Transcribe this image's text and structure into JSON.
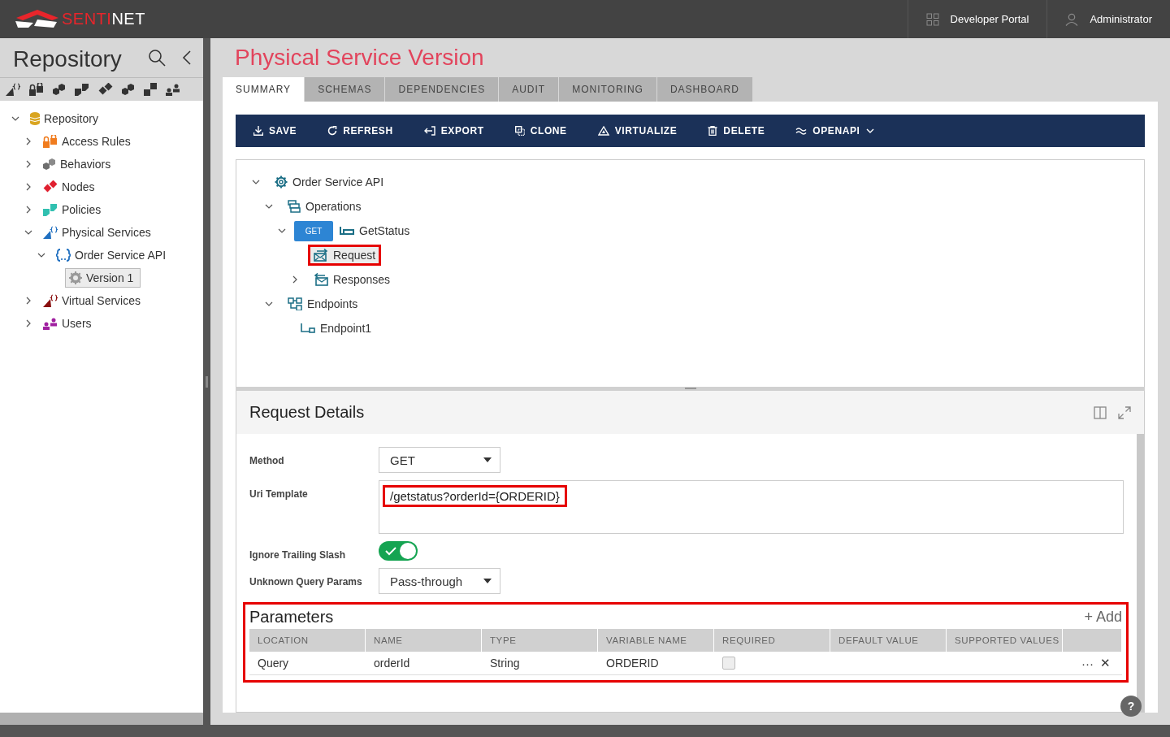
{
  "header": {
    "logo": {
      "accent": "SENTI",
      "rest": "NET"
    },
    "links": [
      {
        "label": "Developer Portal",
        "kind": "grid"
      },
      {
        "label": "Administrator",
        "kind": "user"
      }
    ]
  },
  "sidebar": {
    "title": "Repository",
    "tree": [
      {
        "label": "Repository",
        "kind": "database",
        "expanded": true,
        "selected": false,
        "children": [
          {
            "label": "Access Rules",
            "kind": "lock",
            "expanded": false,
            "selected": false
          },
          {
            "label": "Behaviors",
            "kind": "behaviors",
            "expanded": false,
            "selected": false
          },
          {
            "label": "Nodes",
            "kind": "nodes",
            "expanded": false,
            "selected": false
          },
          {
            "label": "Policies",
            "kind": "policies",
            "expanded": false,
            "selected": false
          },
          {
            "label": "Physical Services",
            "kind": "physical",
            "expanded": true,
            "selected": false,
            "children": [
              {
                "label": "Order Service API",
                "kind": "api",
                "expanded": true,
                "selected": false,
                "children": [
                  {
                    "label": "Version 1",
                    "kind": "version",
                    "selected": true
                  }
                ]
              }
            ]
          },
          {
            "label": "Virtual Services",
            "kind": "virtual",
            "expanded": false,
            "selected": false
          },
          {
            "label": "Users",
            "kind": "users",
            "expanded": false,
            "selected": false
          }
        ]
      }
    ]
  },
  "main": {
    "title": "Physical Service Version",
    "tabs": [
      {
        "label": "SUMMARY",
        "selected": true
      },
      {
        "label": "SCHEMAS",
        "selected": false
      },
      {
        "label": "DEPENDENCIES",
        "selected": false
      },
      {
        "label": "AUDIT",
        "selected": false
      },
      {
        "label": "MONITORING",
        "selected": false
      },
      {
        "label": "DASHBOARD",
        "selected": false
      }
    ],
    "actions": [
      {
        "label": "SAVE",
        "kind": "download",
        "dropdown": false
      },
      {
        "label": "REFRESH",
        "kind": "refresh",
        "dropdown": false
      },
      {
        "label": "EXPORT",
        "kind": "export",
        "dropdown": false
      },
      {
        "label": "CLONE",
        "kind": "clone",
        "dropdown": false
      },
      {
        "label": "VIRTUALIZE",
        "kind": "virtualize",
        "dropdown": false
      },
      {
        "label": "DELETE",
        "kind": "trash",
        "dropdown": false
      },
      {
        "label": "OPENAPI",
        "kind": "approx",
        "dropdown": true
      }
    ],
    "tree": [
      {
        "label": "Order Service API",
        "kind": "gear",
        "expanded": true,
        "selected": false,
        "highlighted": false,
        "children": [
          {
            "label": "Operations",
            "kind": "operations",
            "expanded": true,
            "selected": false,
            "highlighted": false,
            "children": [
              {
                "label": "GetStatus",
                "kind": "operation",
                "badge": "GET",
                "expanded": true,
                "selected": false,
                "highlighted": false,
                "children": [
                  {
                    "label": "Request",
                    "kind": "request",
                    "selected": true,
                    "highlighted": true
                  },
                  {
                    "label": "Responses",
                    "kind": "responses",
                    "expanded": false,
                    "selected": false,
                    "highlighted": false
                  }
                ]
              }
            ]
          },
          {
            "label": "Endpoints",
            "kind": "endpoints",
            "expanded": true,
            "selected": false,
            "highlighted": false,
            "children": [
              {
                "label": "Endpoint1",
                "kind": "endpoint",
                "selected": false,
                "highlighted": false
              }
            ]
          }
        ]
      }
    ],
    "details": {
      "title": "Request Details",
      "fields": [
        {
          "kind": "select",
          "label": "Method",
          "value": "GET"
        },
        {
          "kind": "textarea",
          "label": "Uri Template",
          "value": "/getstatus?orderId={ORDERID}",
          "highlighted": true
        },
        {
          "kind": "toggle",
          "label": "Ignore Trailing Slash",
          "on": true
        },
        {
          "kind": "select",
          "label": "Unknown Query Params",
          "value": "Pass-through"
        }
      ],
      "parameters": {
        "title": "Parameters",
        "add_label": "+ Add",
        "highlighted": true,
        "columns": [
          "LOCATION",
          "NAME",
          "TYPE",
          "VARIABLE NAME",
          "REQUIRED",
          "DEFAULT VALUE",
          "SUPPORTED VALUES"
        ],
        "rows": [
          {
            "location": "Query",
            "name": "orderId",
            "type": "String",
            "variable_name": "ORDERID",
            "required": false,
            "more": "···",
            "remove": "✕"
          }
        ]
      },
      "help": "?"
    }
  }
}
